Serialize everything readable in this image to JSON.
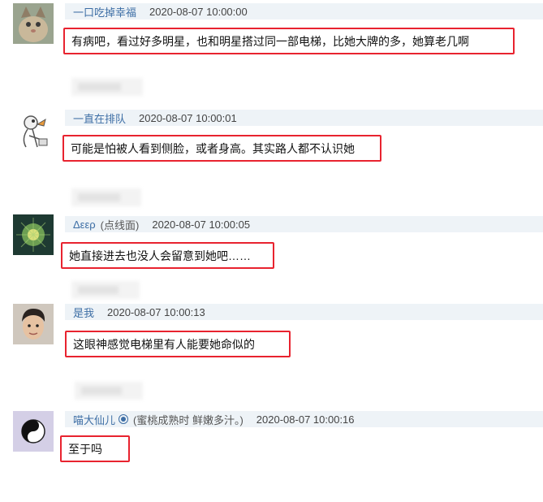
{
  "comments": [
    {
      "username": "一口吃掉幸福",
      "nickname": "",
      "timestamp": "2020-08-07 10:00:00",
      "text": "有病吧，看过好多明星，也和明星搭过同一部电梯，比她大牌的多，她算老几啊"
    },
    {
      "username": "一直在排队",
      "nickname": "",
      "timestamp": "2020-08-07 10:00:01",
      "text": "可能是怕被人看到侧脸，或者身高。其实路人都不认识她"
    },
    {
      "username": "Δεερ",
      "nickname": "(点线面)",
      "timestamp": "2020-08-07 10:00:05",
      "text": "她直接进去也没人会留意到她吧……"
    },
    {
      "username": "是我",
      "nickname": "",
      "timestamp": "2020-08-07 10:00:13",
      "text": "这眼神感觉电梯里有人能要她命似的"
    },
    {
      "username": "喵大仙儿",
      "nickname": "(蜜桃成熟时 鲜嫩多汁。)",
      "timestamp": "2020-08-07 10:00:16",
      "text": "至于吗"
    }
  ],
  "colors": {
    "highlight_border": "#e8232f",
    "username": "#3d6ea5",
    "header_bg": "#eef3f7"
  }
}
